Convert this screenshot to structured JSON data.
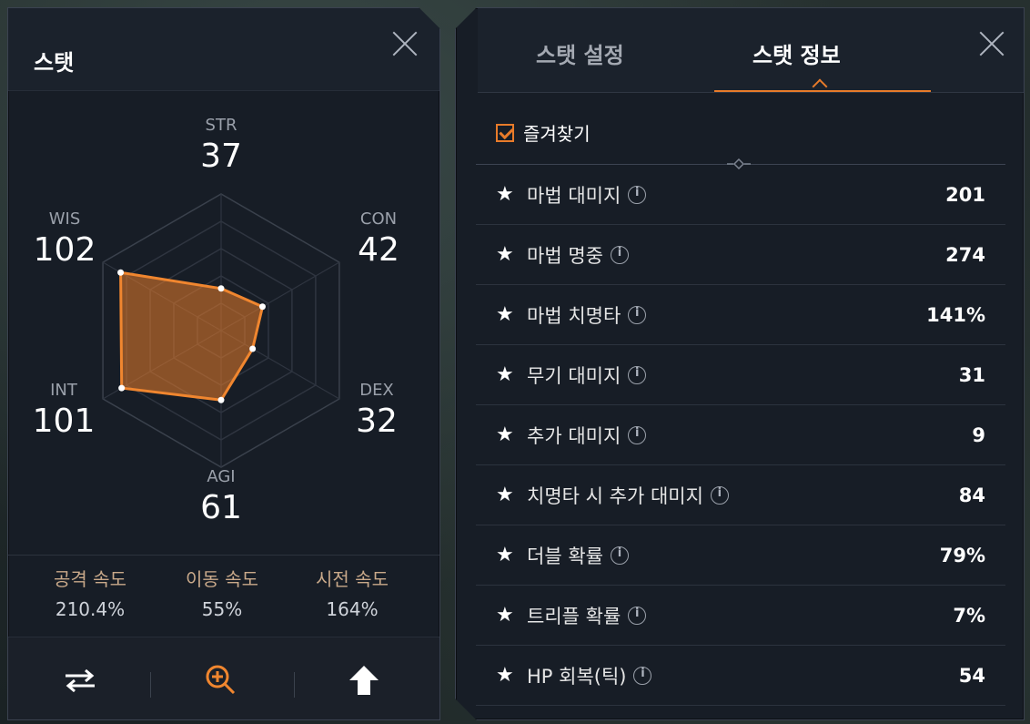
{
  "left": {
    "title": "스탯",
    "stats": [
      {
        "key": "str",
        "label": "STR",
        "value": "37"
      },
      {
        "key": "con",
        "label": "CON",
        "value": "42"
      },
      {
        "key": "dex",
        "label": "DEX",
        "value": "32"
      },
      {
        "key": "agi",
        "label": "AGI",
        "value": "61"
      },
      {
        "key": "int",
        "label": "INT",
        "value": "101"
      },
      {
        "key": "wis",
        "label": "WIS",
        "value": "102"
      }
    ],
    "speeds": [
      {
        "label": "공격 속도",
        "value": "210.4%"
      },
      {
        "label": "이동 속도",
        "value": "55%"
      },
      {
        "label": "시전 속도",
        "value": "164%"
      }
    ],
    "accent_color": "#e87b2a"
  },
  "right": {
    "tabs": [
      {
        "label": "스탯 설정",
        "active": false
      },
      {
        "label": "스탯 정보",
        "active": true
      }
    ],
    "favorites_label": "즐겨찾기",
    "rows": [
      {
        "name": "마법 대미지",
        "value": "201"
      },
      {
        "name": "마법 명중",
        "value": "274"
      },
      {
        "name": "마법 치명타",
        "value": "141%"
      },
      {
        "name": "무기 대미지",
        "value": "31"
      },
      {
        "name": "추가 대미지",
        "value": "9"
      },
      {
        "name": "치명타 시 추가 대미지",
        "value": "84"
      },
      {
        "name": "더블 확률",
        "value": "79%"
      },
      {
        "name": "트리플 확률",
        "value": "7%"
      },
      {
        "name": "HP 회복(틱)",
        "value": "54"
      }
    ]
  }
}
